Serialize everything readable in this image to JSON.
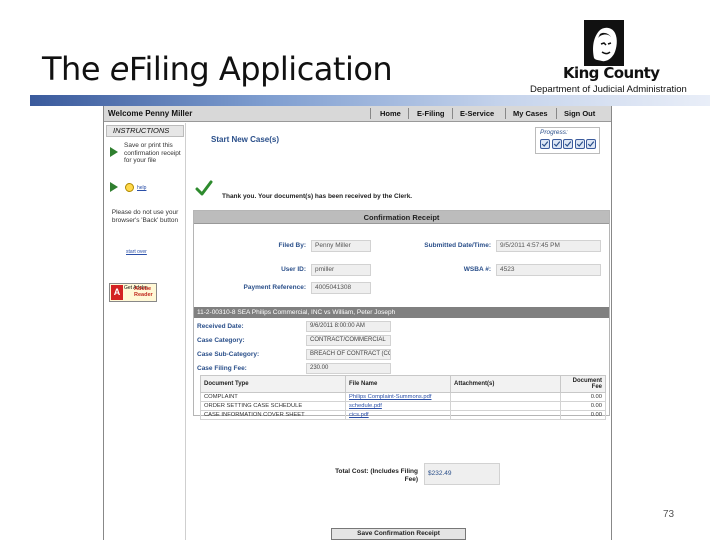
{
  "slide": {
    "title_main": "The ",
    "title_em": "e",
    "title_rest": "Filing Application",
    "logo_text": "King County",
    "department": "Department of Judicial Administration",
    "page_number": "73"
  },
  "app": {
    "welcome": "Welcome Penny Miller",
    "nav": [
      "Home",
      "E-Filing",
      "E-Service",
      "My Cases",
      "Sign Out"
    ],
    "instructions": {
      "header": "INSTRUCTIONS",
      "save_tip": "Save or print this confirmation receipt for your file",
      "help_link": "help",
      "back_warning": "Please do not use your browser's 'Back' button",
      "start_over": "start over",
      "adobe_get": "Get Adobe",
      "adobe_reader": "Adobe Reader"
    },
    "subtitle": "Start New Case(s)",
    "progress_label": "Progress:",
    "progress_steps": 5,
    "thank_you": "Thank you. Your document(s) has been received by the Clerk.",
    "receipt": {
      "header": "Confirmation Receipt",
      "filed_by_label": "Filed By:",
      "filed_by": "Penny Miller",
      "submitted_label": "Submitted Date/Time:",
      "submitted": "9/5/2011 4:57:45 PM",
      "user_id_label": "User ID:",
      "user_id": "pmiller",
      "wsba_label": "WSBA #:",
      "wsba": "4523",
      "payment_label": "Payment Reference:",
      "payment": "4005041308",
      "case_bar": "11-2-00310-8 SEA  Philips Commercial, INC vs William, Peter Joseph",
      "received_label": "Received Date:",
      "received": "9/6/2011 8:00:00 AM",
      "category_label": "Case Category:",
      "category": "CONTRACT/COMMERCIAL",
      "subcategory_label": "Case Sub-Category:",
      "subcategory": "BREACH OF CONTRACT (COM 2)",
      "filing_fee_label": "Case Filing Fee:",
      "filing_fee": "230.00",
      "doc_headers": {
        "type": "Document Type",
        "file": "File Name",
        "attach": "Attachment(s)",
        "fee": "Document Fee"
      },
      "documents": [
        {
          "type": "COMPLAINT",
          "file": "Philips Complaint-Summons.pdf",
          "attach": "",
          "fee": "0.00"
        },
        {
          "type": "ORDER SETTING CASE SCHEDULE",
          "file": "schedule.pdf",
          "attach": "",
          "fee": "0.00"
        },
        {
          "type": "CASE INFORMATION COVER SHEET",
          "file": "cics.pdf",
          "attach": "",
          "fee": "0.00"
        }
      ],
      "total_label": "Total Cost: (Includes Filing Fee)",
      "total": "$232.49"
    },
    "save_button": "Save Confirmation Receipt"
  }
}
